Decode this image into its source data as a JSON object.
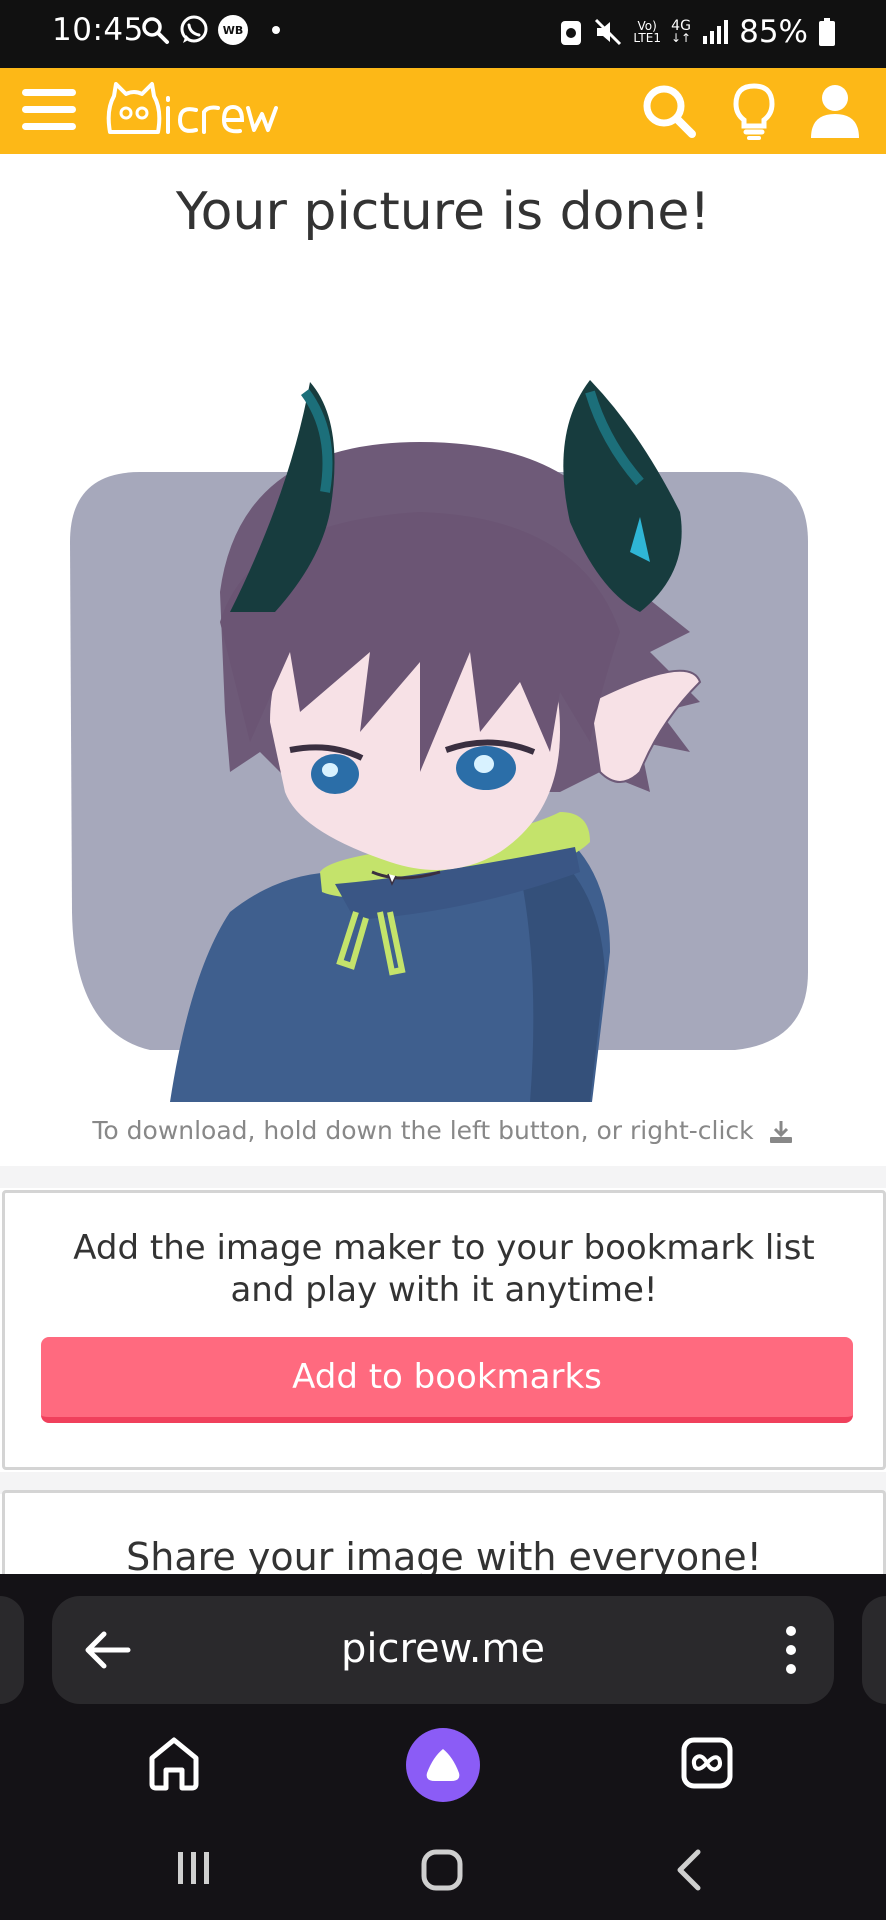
{
  "status_bar": {
    "time": "10:45",
    "wb_badge": "WB",
    "network_top": "Vo)",
    "network_bottom": "LTE1",
    "network_type": "4G",
    "battery": "85%"
  },
  "header": {
    "logo_text": "Picrew",
    "icons": [
      "menu-icon",
      "search-icon",
      "lightbulb-icon",
      "user-icon"
    ],
    "background": "#fdb817"
  },
  "main": {
    "title": "Your picture is done!",
    "download_hint": "To download, hold down the left button, or right-click",
    "bookmark_card": {
      "text": "Add the image maker to your bookmark list and play with it anytime!",
      "button_label": "Add to bookmarks"
    },
    "share_card": {
      "text": "Share your image with everyone!"
    }
  },
  "browser": {
    "url": "picrew.me",
    "icons": [
      "back-arrow-icon",
      "more-vertical-icon",
      "home-icon",
      "alice-assistant-icon",
      "tabs-icon"
    ]
  },
  "system_nav": {
    "icons": [
      "recent-apps-icon",
      "home-circle-icon",
      "back-chevron-icon"
    ]
  },
  "colors": {
    "accent": "#fdb817",
    "bookmark_button": "#ff6a7f",
    "alice": "#8b5cf6"
  }
}
